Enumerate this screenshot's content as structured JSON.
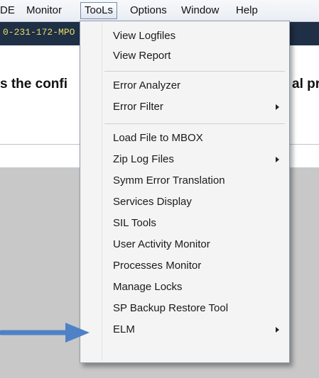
{
  "menubar": {
    "items": [
      {
        "label": "DE"
      },
      {
        "label": "Monitor"
      },
      {
        "label": "TooLs"
      },
      {
        "label": "Options"
      },
      {
        "label": "Window"
      },
      {
        "label": "Help"
      }
    ]
  },
  "title_strip": {
    "text": "0-231-172-MPO"
  },
  "background": {
    "heading_left": "s the confi",
    "heading_right": "al pr"
  },
  "tools_menu": {
    "items": [
      {
        "label": "View Logfiles"
      },
      {
        "label": "View Report"
      },
      {
        "label": "Error Analyzer"
      },
      {
        "label": "Error Filter"
      },
      {
        "label": "Load File to MBOX"
      },
      {
        "label": "Zip Log Files"
      },
      {
        "label": "Symm Error Translation"
      },
      {
        "label": "Services Display"
      },
      {
        "label": "SIL Tools"
      },
      {
        "label": "User Activity Monitor"
      },
      {
        "label": "Processes Monitor"
      },
      {
        "label": "Manage Locks"
      },
      {
        "label": "SP Backup Restore Tool"
      },
      {
        "label": "ELM"
      }
    ]
  },
  "annotation": {
    "arrow_color": "#4f81c7",
    "pointer_icon": "arrow-right-icon"
  }
}
